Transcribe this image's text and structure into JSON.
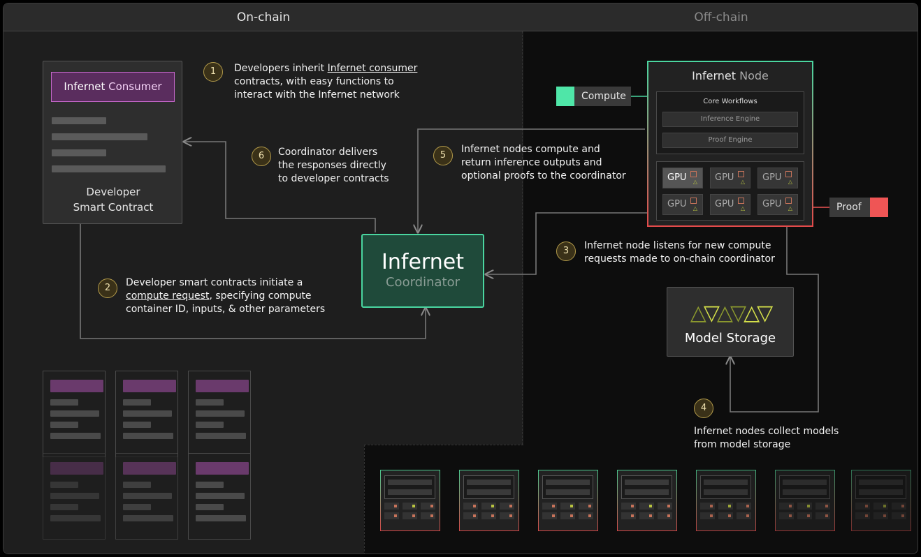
{
  "headers": {
    "on_chain": "On-chain",
    "off_chain": "Off-chain"
  },
  "steps": [
    {
      "num": "1",
      "lines": [
        [
          "Developers inherit ",
          "Infernet consumer"
        ],
        [
          "contracts, with easy functions to"
        ],
        [
          "interact with the Infernet network"
        ]
      ]
    },
    {
      "num": "2",
      "lines": [
        [
          "Developer smart contracts initiate a"
        ],
        [
          "compute request",
          ", specifying compute"
        ],
        [
          "container ID, inputs, & other parameters"
        ]
      ]
    },
    {
      "num": "3",
      "lines": [
        [
          "Infernet node listens for new compute"
        ],
        [
          "requests made to on-chain coordinator"
        ]
      ]
    },
    {
      "num": "4",
      "lines": [
        [
          "Infernet nodes collect models"
        ],
        [
          "from model storage"
        ]
      ]
    },
    {
      "num": "5",
      "lines": [
        [
          "Infernet nodes compute and"
        ],
        [
          "return inference outputs and"
        ],
        [
          "optional proofs to the coordinator"
        ]
      ]
    },
    {
      "num": "6",
      "lines": [
        [
          "Coordinator delivers"
        ],
        [
          "the responses directly"
        ],
        [
          "to developer contracts"
        ]
      ]
    }
  ],
  "step_text": {
    "s1a": "Developers inherit ",
    "s1u": "Infernet consumer",
    "s1b": "contracts, with easy functions to",
    "s1c": "interact with the Infernet network",
    "s2a": "Developer smart contracts initiate a",
    "s2u": "compute request",
    "s2b": ", specifying compute",
    "s2c": "container ID, inputs, & other parameters",
    "s3a": "Infernet node listens for new compute",
    "s3b": "requests made to on-chain coordinator",
    "s4a": "Infernet nodes collect models",
    "s4b": "from model storage",
    "s5a": "Infernet nodes compute and",
    "s5b": "return inference outputs and",
    "s5c": "optional proofs to the coordinator",
    "s6a": "Coordinator delivers",
    "s6b": "the responses directly",
    "s6c": "to developer contracts"
  },
  "developer_contract": {
    "consumer_bold": "Infernet",
    "consumer_rest": " Consumer",
    "label_line1": "Developer",
    "label_line2": "Smart Contract"
  },
  "coordinator": {
    "title": "Infernet",
    "subtitle": "Coordinator"
  },
  "node": {
    "title_bold": "Infernet",
    "title_rest": " Node",
    "core_workflows": "Core Workflows",
    "inference_engine": "Inference Engine",
    "proof_engine": "Proof Engine",
    "gpu_label": "GPU"
  },
  "compute_label": "Compute",
  "proof_label": "Proof",
  "model_storage": {
    "label": "Model Storage"
  },
  "colors": {
    "green": "#4ad6a0",
    "red": "#ef5555",
    "purple": "#c467c9",
    "gold": "#b29a4a",
    "lime": "#b8c340"
  }
}
